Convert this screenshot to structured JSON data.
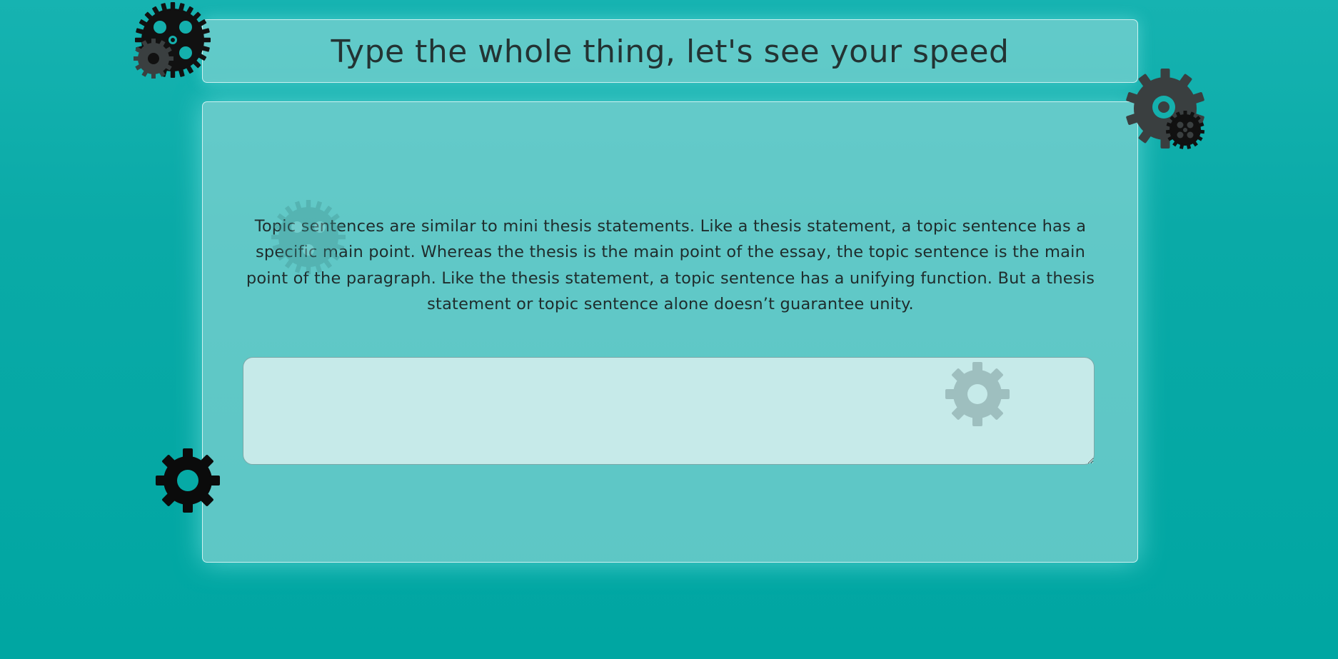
{
  "header": {
    "title": "Type the whole thing, let's see your speed"
  },
  "passage": {
    "text": "Topic sentences are similar to mini thesis statements. Like a thesis statement, a topic sentence has a specific main point. Whereas the thesis is the main point of the essay, the topic sentence is the main point of the paragraph. Like the thesis statement, a topic sentence has a unifying function. But a thesis statement or topic sentence alone doesn’t guarantee unity."
  },
  "typing_input": {
    "value": "",
    "placeholder": ""
  },
  "colors": {
    "background": "#00a6a2",
    "panel": "#73cdcb",
    "input": "#c6eae9",
    "text": "#1f2c2c",
    "gear_dark": "#111111",
    "gear_gray": "#3a3f40"
  },
  "icons": [
    "gear-icon-top-left",
    "gear-icon-top-right",
    "gear-icon-faded-passage",
    "gear-icon-faded-input",
    "gear-icon-left"
  ]
}
